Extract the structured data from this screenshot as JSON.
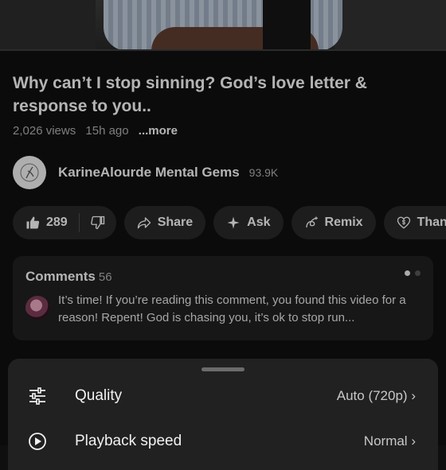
{
  "video": {
    "title": "Why can’t I stop sinning? God’s love letter & response to you..",
    "views": "2,026 views",
    "age": "15h ago",
    "more_label": "...more"
  },
  "channel": {
    "name": "KarineAlourde Mental Gems",
    "subscribers": "93.9K"
  },
  "actions": {
    "likes": "289",
    "share": "Share",
    "ask": "Ask",
    "remix": "Remix",
    "thanks": "Thank"
  },
  "comments": {
    "heading": "Comments",
    "count": "56",
    "top_comment": "It’s time! If you’re reading this comment, you found this video for a reason! Repent! God is chasing you, it’s ok to stop run..."
  },
  "settings_sheet": {
    "items": [
      {
        "label": "Quality",
        "value": "Auto (720p)",
        "icon": "sliders-icon"
      },
      {
        "label": "Playback speed",
        "value": "Normal",
        "icon": "playback-speed-icon"
      }
    ]
  },
  "colors": {
    "background": "#0f0f0f",
    "pill": "#272727",
    "sheet": "#212121",
    "text": "#f1f1f1",
    "muted": "#aaaaaa"
  }
}
